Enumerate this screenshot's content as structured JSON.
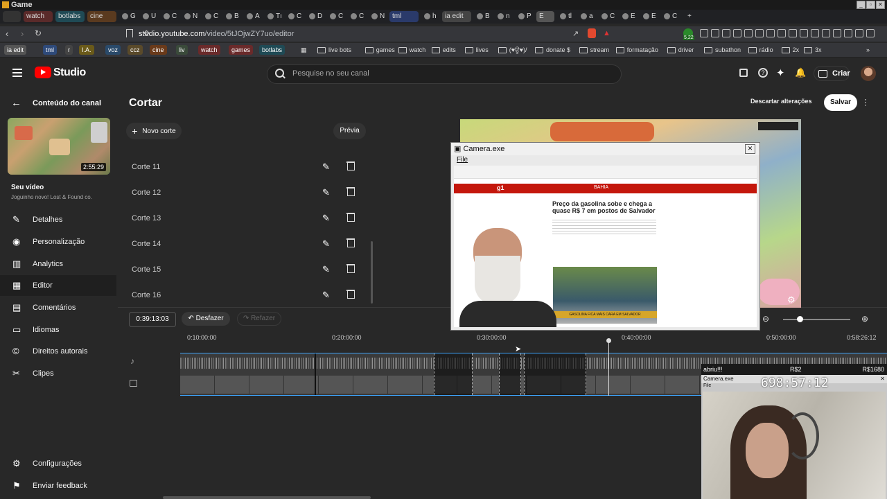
{
  "os": {
    "title": "Game"
  },
  "tabs": [
    {
      "label": "",
      "color": "#333"
    },
    {
      "label": "watch",
      "color": "#5a2a2a"
    },
    {
      "label": "botlabs",
      "color": "#1f4a55"
    },
    {
      "label": "cine",
      "color": "#5a3a1f"
    },
    {
      "label": "G",
      "color": ""
    },
    {
      "label": "U",
      "color": ""
    },
    {
      "label": "C",
      "color": ""
    },
    {
      "label": "N",
      "color": ""
    },
    {
      "label": "C",
      "color": ""
    },
    {
      "label": "B",
      "color": ""
    },
    {
      "label": "A",
      "color": ""
    },
    {
      "label": "Tı",
      "color": ""
    },
    {
      "label": "C",
      "color": ""
    },
    {
      "label": "D",
      "color": ""
    },
    {
      "label": "C",
      "color": ""
    },
    {
      "label": "C",
      "color": ""
    },
    {
      "label": "N",
      "color": ""
    },
    {
      "label": "tml",
      "color": "#2a3a6a"
    },
    {
      "label": "h",
      "color": ""
    },
    {
      "label": "ia edit",
      "color": "#444"
    },
    {
      "label": "B",
      "color": ""
    },
    {
      "label": "n",
      "color": ""
    },
    {
      "label": "P",
      "color": ""
    },
    {
      "label": "E",
      "color": "#555"
    },
    {
      "label": "tl",
      "color": ""
    },
    {
      "label": "a",
      "color": ""
    },
    {
      "label": "C",
      "color": ""
    },
    {
      "label": "E",
      "color": ""
    },
    {
      "label": "E",
      "color": ""
    },
    {
      "label": "C",
      "color": ""
    }
  ],
  "address": {
    "host": "studio.youtube.com",
    "path": "/video/5tJOjwZY7uo/editor"
  },
  "extension_badge": "5,22",
  "bookmarks": {
    "chips": [
      {
        "label": "ia edit",
        "color": "#555"
      },
      {
        "label": "tml",
        "color": "#2e4a7a"
      },
      {
        "label": "r",
        "color": "#444"
      },
      {
        "label": "I.A.",
        "color": "#6a5a1a"
      },
      {
        "label": "voz",
        "color": "#2a4a6a"
      },
      {
        "label": "ccz",
        "color": "#5a4a2a"
      },
      {
        "label": "cine",
        "color": "#6a3a1a"
      },
      {
        "label": "liv",
        "color": "#3a4a3a"
      },
      {
        "label": "watch",
        "color": "#6a2a2a"
      },
      {
        "label": "games",
        "color": "#6a2a2a"
      },
      {
        "label": "botlabs",
        "color": "#1f4a55"
      }
    ],
    "folders": [
      "live bots",
      "games",
      "watch",
      "edits",
      "lives",
      "(♥ਊ♥)/",
      "donate $",
      "stream",
      "formatação",
      "driver",
      "subathon",
      "rádio",
      "2x",
      "3x"
    ]
  },
  "studio": {
    "logo": "Studio",
    "search_placeholder": "Pesquise no seu canal",
    "create_label": "Criar",
    "back_label": "Conteúdo do canal",
    "page_title": "Cortar",
    "discard_label": "Descartar alterações",
    "save_label": "Salvar",
    "video_duration": "2:55:29",
    "video_heading": "Seu vídeo",
    "video_title": "Joguinho novo! Lost & Found co.",
    "nav": [
      "Detalhes",
      "Personalização",
      "Analytics",
      "Editor",
      "Comentários",
      "Idiomas",
      "Direitos autorais",
      "Clipes"
    ],
    "footer_nav": [
      "Configurações",
      "Enviar feedback"
    ],
    "new_cut_label": "Novo corte",
    "preview_label": "Prévia",
    "cuts": [
      "Corte 11",
      "Corte 12",
      "Corte 13",
      "Corte 14",
      "Corte 15",
      "Corte 16"
    ],
    "current_time": "0:39:13:03",
    "undo_label": "Desfazer",
    "redo_label": "Refazer",
    "timecodes": [
      "0:10:00:00",
      "0:20:00:00",
      "0:30:00:00",
      "0:40:00:00",
      "0:50:00:00",
      "0:58:26:12"
    ]
  },
  "camera1": {
    "title": "Camera.exe",
    "menu": "File",
    "headline": "Preço da gasolina sobe e chega a quase R$ 7 em postos de Salvador",
    "site_region": "BAHIA",
    "site_logo": "g1",
    "video_caption": "GASOLINA FICA MAIS CARA EM SALVADOR"
  },
  "camera2": {
    "banner_left": "abriu!!!",
    "banner_mid": "R$2",
    "banner_right": "R$1680",
    "title": "Camera.exe",
    "menu": "File",
    "timer": "698:57:12"
  },
  "colors": {
    "accent": "#3ea6ff",
    "studio_red": "#ff0000",
    "bg": "#282828"
  }
}
